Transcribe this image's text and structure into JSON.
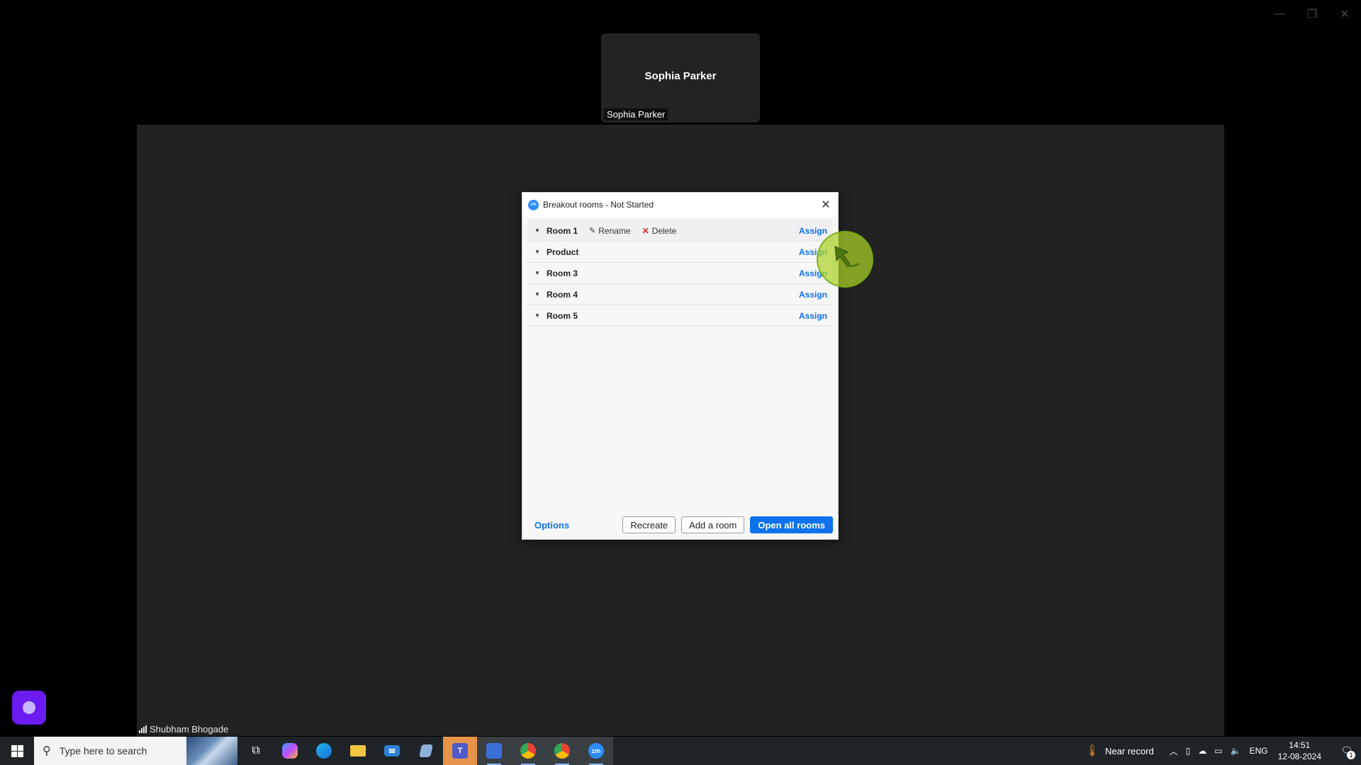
{
  "window_controls": {
    "minimize": "—",
    "restore": "❐",
    "close": "✕"
  },
  "participant": {
    "name": "Sophia Parker",
    "label": "Sophia Parker"
  },
  "stage_user": "Shubham Bhogade",
  "dialog": {
    "title": "Breakout rooms - Not Started",
    "logo_text": "zm",
    "rooms": [
      {
        "name": "Room 1",
        "rename": "Rename",
        "delete": "Delete",
        "assign": "Assign"
      },
      {
        "name": "Product",
        "assign": "Assign"
      },
      {
        "name": "Room 3",
        "assign": "Assign"
      },
      {
        "name": "Room 4",
        "assign": "Assign"
      },
      {
        "name": "Room 5",
        "assign": "Assign"
      }
    ],
    "footer": {
      "options": "Options",
      "recreate": "Recreate",
      "add_room": "Add a room",
      "open_all": "Open all rooms"
    }
  },
  "taskbar": {
    "search_placeholder": "Type here to search",
    "weather": "Near record",
    "language": "ENG",
    "time": "14:51",
    "date": "12-08-2024",
    "notification_count": "1"
  },
  "colors": {
    "accent": "#0e72ed",
    "delete_red": "#e02828",
    "widget_purple": "#6b1cf0",
    "click_indicator": "#aad228"
  }
}
